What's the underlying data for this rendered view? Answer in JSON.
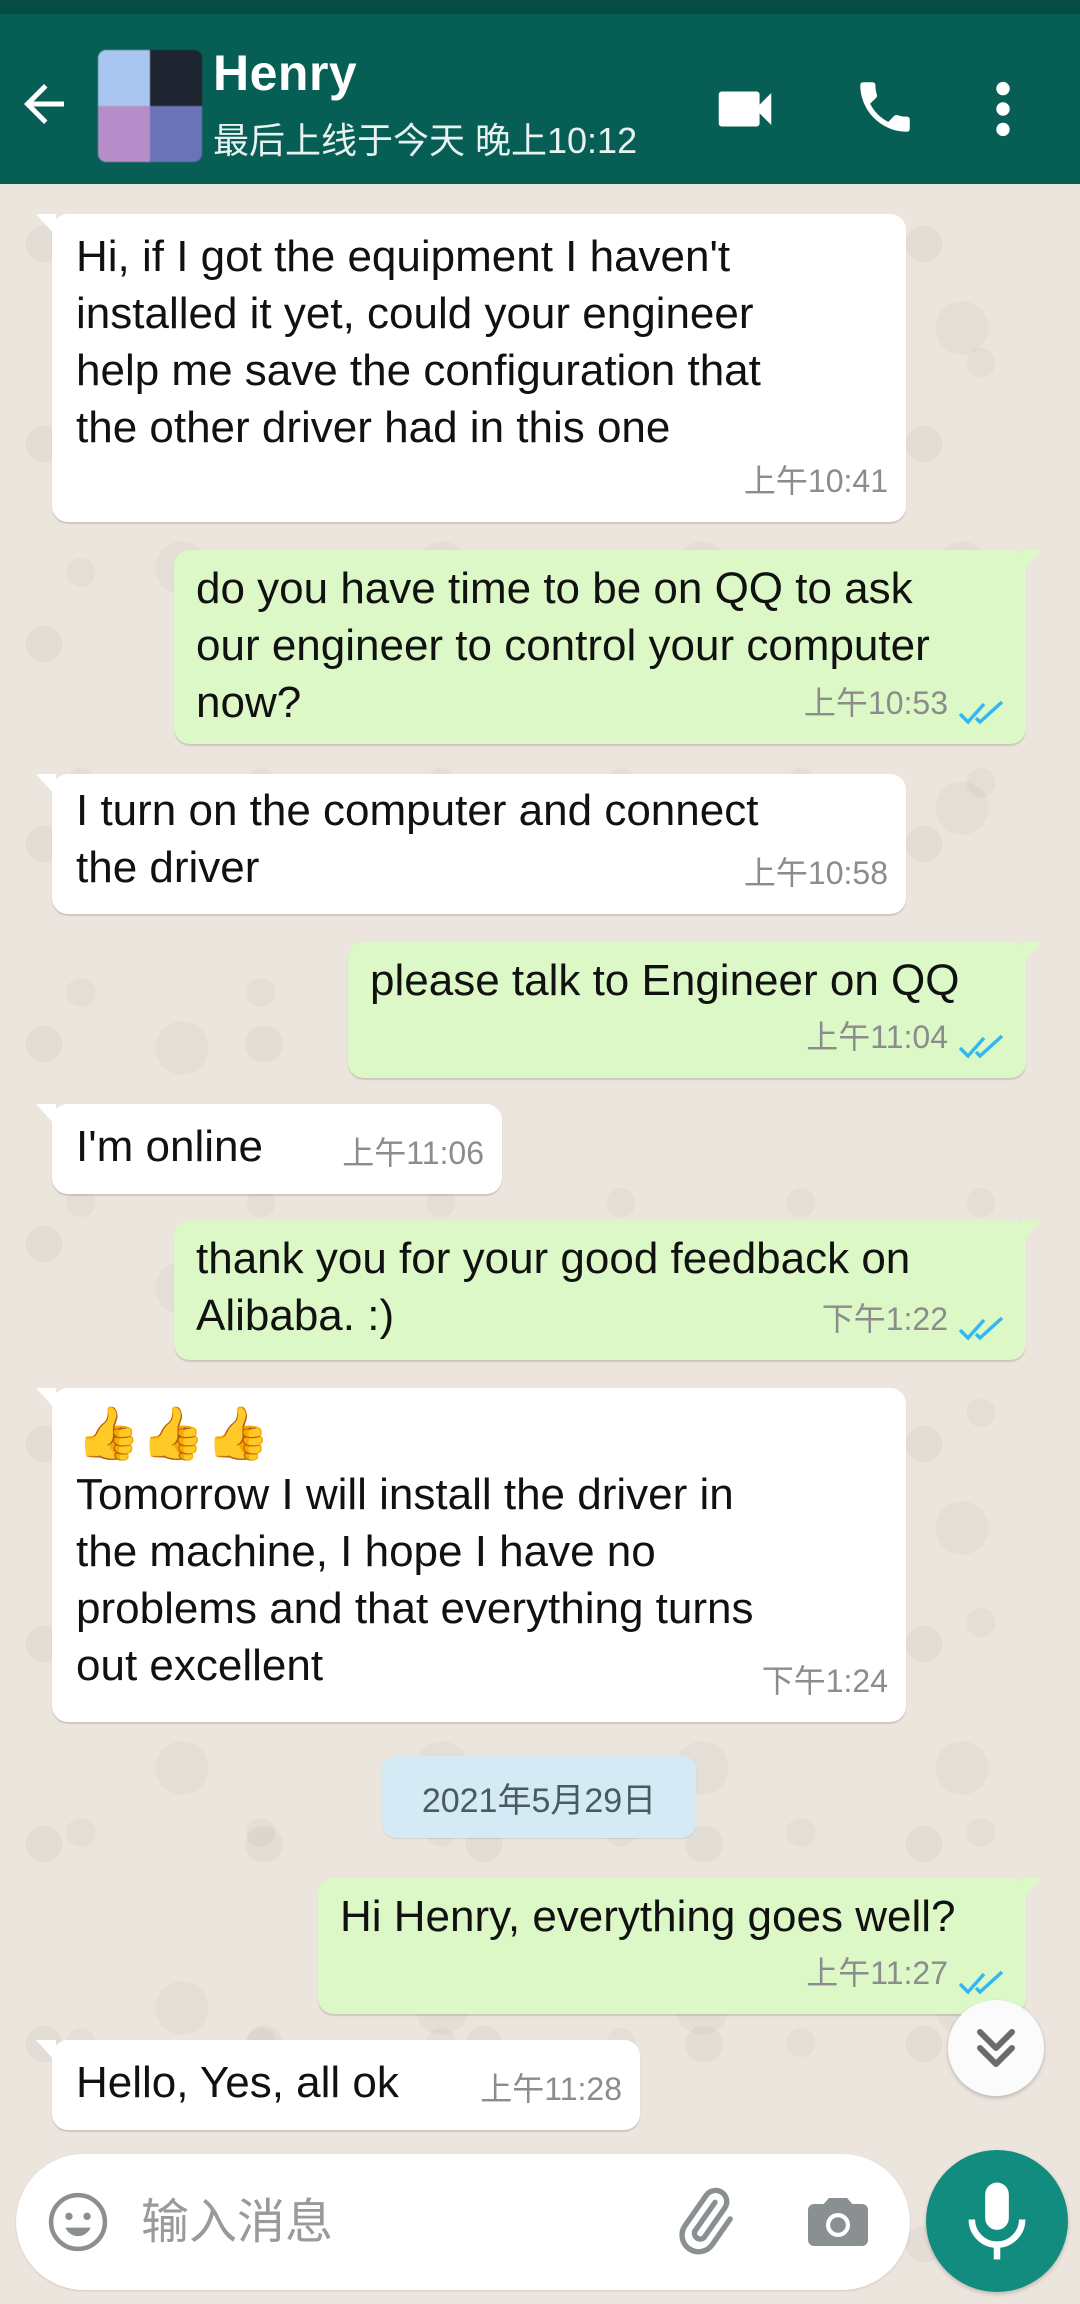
{
  "header": {
    "contact_name": "Henry",
    "last_seen": "最后上线于今天 晚上10:12"
  },
  "messages": [
    {
      "direction": "in",
      "lines": [
        "Hi, if I got the equipment I haven't",
        "installed it yet, could your engineer",
        "help me save the configuration that",
        "the other driver had in this one"
      ],
      "time": "上午10:41"
    },
    {
      "direction": "out",
      "lines": [
        "do you have time to be on QQ to ask",
        "our engineer to control your computer",
        "now?"
      ],
      "time": "上午10:53",
      "status": "read"
    },
    {
      "direction": "in",
      "lines": [
        "I turn on the computer and connect",
        "the driver"
      ],
      "time": "上午10:58"
    },
    {
      "direction": "out",
      "lines": [
        "please talk to Engineer on QQ"
      ],
      "time": "上午11:04",
      "status": "read"
    },
    {
      "direction": "in",
      "lines": [
        "I'm online"
      ],
      "time": "上午11:06"
    },
    {
      "direction": "out",
      "lines": [
        "thank you for your good feedback on",
        "Alibaba. :)"
      ],
      "time": "下午1:22",
      "status": "read"
    },
    {
      "direction": "in",
      "emoji": "👍👍👍",
      "lines": [
        "Tomorrow I will install the driver in",
        "the machine, I hope I have no",
        "problems and that everything turns",
        "out excellent"
      ],
      "time": "下午1:24"
    },
    {
      "direction": "out",
      "lines": [
        "Hi Henry, everything goes well?"
      ],
      "time": "上午11:27",
      "status": "read"
    },
    {
      "direction": "in",
      "lines": [
        "Hello, Yes, all ok"
      ],
      "time": "上午11:28"
    }
  ],
  "date_divider": "2021年5月29日",
  "composer": {
    "placeholder": "输入消息"
  },
  "colors": {
    "header": "#075e54",
    "outgoing_bubble": "#dcf8c6",
    "incoming_bubble": "#ffffff",
    "read_ticks": "#34b7f1",
    "mic_button": "#128c7e"
  },
  "icons": [
    "back-arrow-icon",
    "video-call-icon",
    "phone-icon",
    "more-vert-icon",
    "double-chevron-down-icon",
    "emoji-icon",
    "attach-icon",
    "camera-icon",
    "mic-icon",
    "double-check-icon"
  ]
}
